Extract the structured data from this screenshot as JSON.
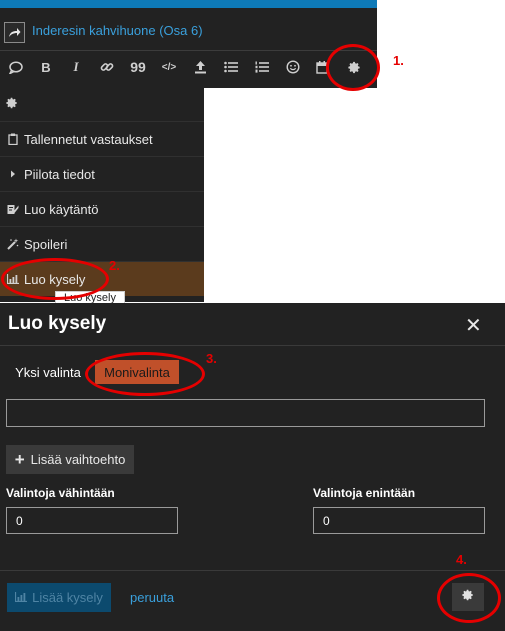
{
  "composer": {
    "topic_title": "Inderesin kahvihuone (Osa 6)",
    "toolbar_icons": [
      "speech-bubble-icon",
      "bold-icon",
      "italic-icon",
      "link-icon",
      "quote-icon",
      "code-icon",
      "upload-icon",
      "bullet-list-icon",
      "numbered-list-icon",
      "emoji-icon",
      "calendar-icon",
      "gear-icon"
    ],
    "bold_glyph": "B",
    "italic_glyph": "I",
    "quote_glyph": "99",
    "code_glyph": "</>"
  },
  "menu": {
    "items": [
      {
        "label": "Tallennetut vastaukset",
        "icon": "clipboard-icon"
      },
      {
        "label": "Piilota tiedot",
        "icon": "caret-right-icon"
      },
      {
        "label": "Luo käytäntö",
        "icon": "policy-icon"
      },
      {
        "label": "Spoileri",
        "icon": "magic-wand-icon"
      },
      {
        "label": "Luo kysely",
        "icon": "chart-icon"
      }
    ],
    "tooltip": "Luo kysely"
  },
  "modal": {
    "title": "Luo kysely",
    "close_glyph": "✕",
    "tabs": {
      "single": "Yksi valinta",
      "multi": "Monivalinta"
    },
    "option_value": "",
    "add_option_label": "Lisää vaihtoehto",
    "add_option_glyph": "+",
    "min_label": "Valintoja vähintään",
    "min_value": "0",
    "max_label": "Valintoja enintään",
    "max_value": "0",
    "add_poll_label": "Lisää kysely",
    "cancel_label": "peruuta"
  },
  "annotations": [
    "1.",
    "2.",
    "3.",
    "4."
  ],
  "colors": {
    "panel": "#222222",
    "accent_blue": "#0e7ab8",
    "link_blue": "#3aa0dc",
    "selected_tab": "#c0502a",
    "menu_highlight": "#5b3b1d",
    "annotation_red": "#e50000"
  }
}
